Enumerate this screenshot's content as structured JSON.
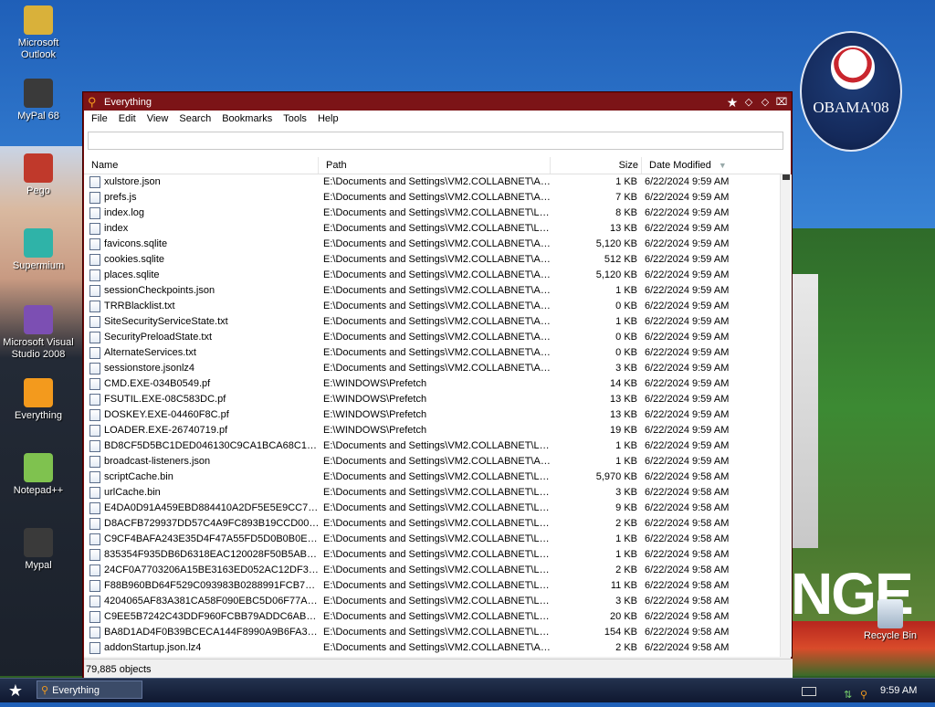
{
  "desktop": {
    "icons": [
      {
        "label": "Microsoft Outlook",
        "icon": "outlook-icon"
      },
      {
        "label": "MyPal 68",
        "icon": "mypal-icon"
      },
      {
        "label": "Pego",
        "icon": "pego-icon"
      },
      {
        "label": "Supermium",
        "icon": "supermium-icon"
      },
      {
        "label": "Microsoft Visual Studio 2008",
        "icon": "visual-studio-icon"
      },
      {
        "label": "Everything",
        "icon": "everything-icon"
      },
      {
        "label": "Notepad++",
        "icon": "notepadpp-icon"
      },
      {
        "label": "Mypal",
        "icon": "mypal-icon"
      }
    ],
    "recycle_bin": "Recycle Bin",
    "badge_text": "OBAMA'08",
    "sign_text": "NGE",
    "colors": {
      "title_bar": "#7c1417",
      "badge": "#14295a"
    }
  },
  "window": {
    "title": "Everything",
    "menu": [
      "File",
      "Edit",
      "View",
      "Search",
      "Bookmarks",
      "Tools",
      "Help"
    ],
    "search_value": "",
    "columns": {
      "name": "Name",
      "path": "Path",
      "size": "Size",
      "date": "Date Modified"
    },
    "rows": [
      {
        "name": "xulstore.json",
        "path": "E:\\Documents and Settings\\VM2.COLLABNET\\Ap...",
        "size": "1 KB",
        "date": "6/22/2024 9:59 AM"
      },
      {
        "name": "prefs.js",
        "path": "E:\\Documents and Settings\\VM2.COLLABNET\\Ap...",
        "size": "7 KB",
        "date": "6/22/2024 9:59 AM"
      },
      {
        "name": "index.log",
        "path": "E:\\Documents and Settings\\VM2.COLLABNET\\Loc...",
        "size": "8 KB",
        "date": "6/22/2024 9:59 AM"
      },
      {
        "name": "index",
        "path": "E:\\Documents and Settings\\VM2.COLLABNET\\Loc...",
        "size": "13 KB",
        "date": "6/22/2024 9:59 AM"
      },
      {
        "name": "favicons.sqlite",
        "path": "E:\\Documents and Settings\\VM2.COLLABNET\\Ap...",
        "size": "5,120 KB",
        "date": "6/22/2024 9:59 AM"
      },
      {
        "name": "cookies.sqlite",
        "path": "E:\\Documents and Settings\\VM2.COLLABNET\\Ap...",
        "size": "512 KB",
        "date": "6/22/2024 9:59 AM"
      },
      {
        "name": "places.sqlite",
        "path": "E:\\Documents and Settings\\VM2.COLLABNET\\Ap...",
        "size": "5,120 KB",
        "date": "6/22/2024 9:59 AM"
      },
      {
        "name": "sessionCheckpoints.json",
        "path": "E:\\Documents and Settings\\VM2.COLLABNET\\Ap...",
        "size": "1 KB",
        "date": "6/22/2024 9:59 AM"
      },
      {
        "name": "TRRBlacklist.txt",
        "path": "E:\\Documents and Settings\\VM2.COLLABNET\\Ap...",
        "size": "0 KB",
        "date": "6/22/2024 9:59 AM"
      },
      {
        "name": "SiteSecurityServiceState.txt",
        "path": "E:\\Documents and Settings\\VM2.COLLABNET\\Ap...",
        "size": "1 KB",
        "date": "6/22/2024 9:59 AM"
      },
      {
        "name": "SecurityPreloadState.txt",
        "path": "E:\\Documents and Settings\\VM2.COLLABNET\\Ap...",
        "size": "0 KB",
        "date": "6/22/2024 9:59 AM"
      },
      {
        "name": "AlternateServices.txt",
        "path": "E:\\Documents and Settings\\VM2.COLLABNET\\Ap...",
        "size": "0 KB",
        "date": "6/22/2024 9:59 AM"
      },
      {
        "name": "sessionstore.jsonlz4",
        "path": "E:\\Documents and Settings\\VM2.COLLABNET\\Ap...",
        "size": "3 KB",
        "date": "6/22/2024 9:59 AM"
      },
      {
        "name": "CMD.EXE-034B0549.pf",
        "path": "E:\\WINDOWS\\Prefetch",
        "size": "14 KB",
        "date": "6/22/2024 9:59 AM"
      },
      {
        "name": "FSUTIL.EXE-08C583DC.pf",
        "path": "E:\\WINDOWS\\Prefetch",
        "size": "13 KB",
        "date": "6/22/2024 9:59 AM"
      },
      {
        "name": "DOSKEY.EXE-04460F8C.pf",
        "path": "E:\\WINDOWS\\Prefetch",
        "size": "13 KB",
        "date": "6/22/2024 9:59 AM"
      },
      {
        "name": "LOADER.EXE-26740719.pf",
        "path": "E:\\WINDOWS\\Prefetch",
        "size": "19 KB",
        "date": "6/22/2024 9:59 AM"
      },
      {
        "name": "BD8CF5D5BC1DED046130C9CA1BCA68C154...",
        "path": "E:\\Documents and Settings\\VM2.COLLABNET\\Loc...",
        "size": "1 KB",
        "date": "6/22/2024 9:59 AM"
      },
      {
        "name": "broadcast-listeners.json",
        "path": "E:\\Documents and Settings\\VM2.COLLABNET\\Ap...",
        "size": "1 KB",
        "date": "6/22/2024 9:59 AM"
      },
      {
        "name": "scriptCache.bin",
        "path": "E:\\Documents and Settings\\VM2.COLLABNET\\Loc...",
        "size": "5,970 KB",
        "date": "6/22/2024 9:58 AM"
      },
      {
        "name": "urlCache.bin",
        "path": "E:\\Documents and Settings\\VM2.COLLABNET\\Loc...",
        "size": "3 KB",
        "date": "6/22/2024 9:58 AM"
      },
      {
        "name": "E4DA0D91A459EBD884410A2DF5E5E9CC7AB...",
        "path": "E:\\Documents and Settings\\VM2.COLLABNET\\Loc...",
        "size": "9 KB",
        "date": "6/22/2024 9:58 AM"
      },
      {
        "name": "D8ACFB729937DD57C4A9FC893B19CCD007...",
        "path": "E:\\Documents and Settings\\VM2.COLLABNET\\Loc...",
        "size": "2 KB",
        "date": "6/22/2024 9:58 AM"
      },
      {
        "name": "C9CF4BAFA243E35D4F47A55FD5D0B0B0E28...",
        "path": "E:\\Documents and Settings\\VM2.COLLABNET\\Loc...",
        "size": "1 KB",
        "date": "6/22/2024 9:58 AM"
      },
      {
        "name": "835354F935DB6D6318EAC120028F50B5AB2...",
        "path": "E:\\Documents and Settings\\VM2.COLLABNET\\Loc...",
        "size": "1 KB",
        "date": "6/22/2024 9:58 AM"
      },
      {
        "name": "24CF0A7703206A15BE3163ED052AC12DF31...",
        "path": "E:\\Documents and Settings\\VM2.COLLABNET\\Loc...",
        "size": "2 KB",
        "date": "6/22/2024 9:58 AM"
      },
      {
        "name": "F88B960BD64F529C093983B0288991FCB73E...",
        "path": "E:\\Documents and Settings\\VM2.COLLABNET\\Loc...",
        "size": "11 KB",
        "date": "6/22/2024 9:58 AM"
      },
      {
        "name": "4204065AF83A381CA58F090EBC5D06F77AA...",
        "path": "E:\\Documents and Settings\\VM2.COLLABNET\\Loc...",
        "size": "3 KB",
        "date": "6/22/2024 9:58 AM"
      },
      {
        "name": "C9EE5B7242C43DDF960FCBB79ADDC6ABD6...",
        "path": "E:\\Documents and Settings\\VM2.COLLABNET\\Loc...",
        "size": "20 KB",
        "date": "6/22/2024 9:58 AM"
      },
      {
        "name": "BA8D1AD4F0B39BCECA144F8990A9B6FA3C7...",
        "path": "E:\\Documents and Settings\\VM2.COLLABNET\\Loc...",
        "size": "154 KB",
        "date": "6/22/2024 9:58 AM"
      },
      {
        "name": "addonStartup.json.lz4",
        "path": "E:\\Documents and Settings\\VM2.COLLABNET\\Ap...",
        "size": "2 KB",
        "date": "6/22/2024 9:58 AM"
      }
    ],
    "status": "79,885 objects"
  },
  "taskbar": {
    "task": "Everything",
    "clock": "9:59 AM"
  }
}
